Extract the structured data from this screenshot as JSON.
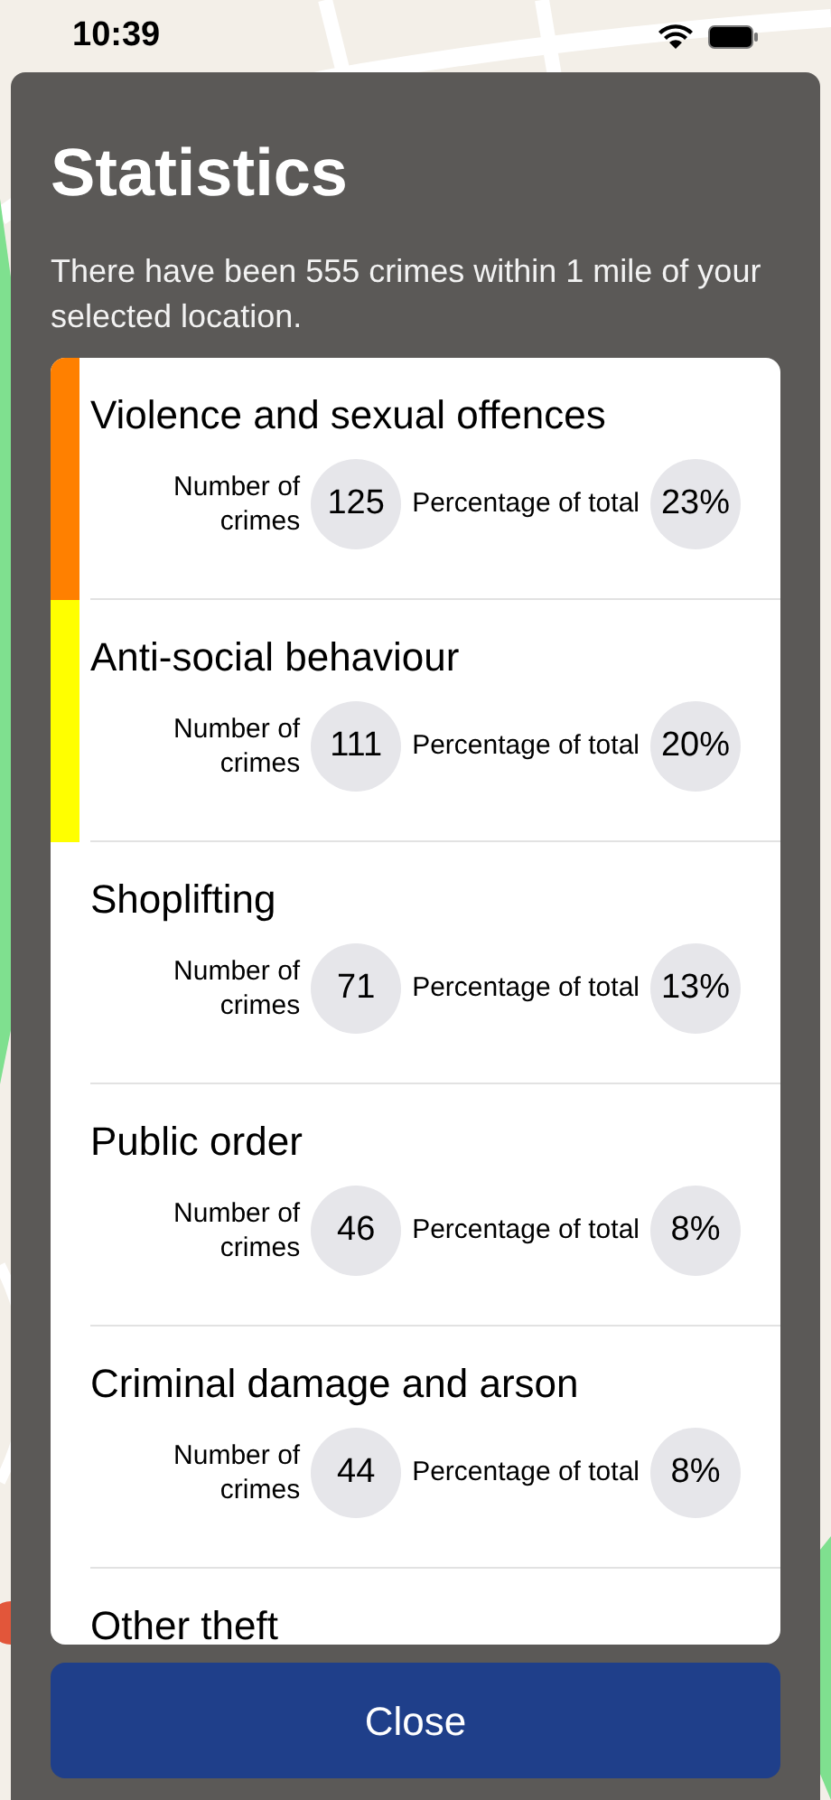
{
  "status_bar": {
    "time": "10:39"
  },
  "title": "Statistics",
  "summary": "There have been 555 crimes within 1 mile of your selected location.",
  "crimes": [
    {
      "category": "Violence and sexual offences",
      "count_label": "Number of crimes",
      "count": "125",
      "percent_label": "Percentage of total",
      "percent": "23%",
      "color": "#ff8000"
    },
    {
      "category": "Anti-social behaviour",
      "count_label": "Number of crimes",
      "count": "111",
      "percent_label": "Percentage of total",
      "percent": "20%",
      "color": "#ffff00"
    },
    {
      "category": "Shoplifting",
      "count_label": "Number of crimes",
      "count": "71",
      "percent_label": "Percentage of total",
      "percent": "13%"
    },
    {
      "category": "Public order",
      "count_label": "Number of crimes",
      "count": "46",
      "percent_label": "Percentage of total",
      "percent": "8%"
    },
    {
      "category": "Criminal damage and arson",
      "count_label": "Number of crimes",
      "count": "44",
      "percent_label": "Percentage of total",
      "percent": "8%"
    },
    {
      "category": "Other theft"
    }
  ],
  "close_button": "Close"
}
